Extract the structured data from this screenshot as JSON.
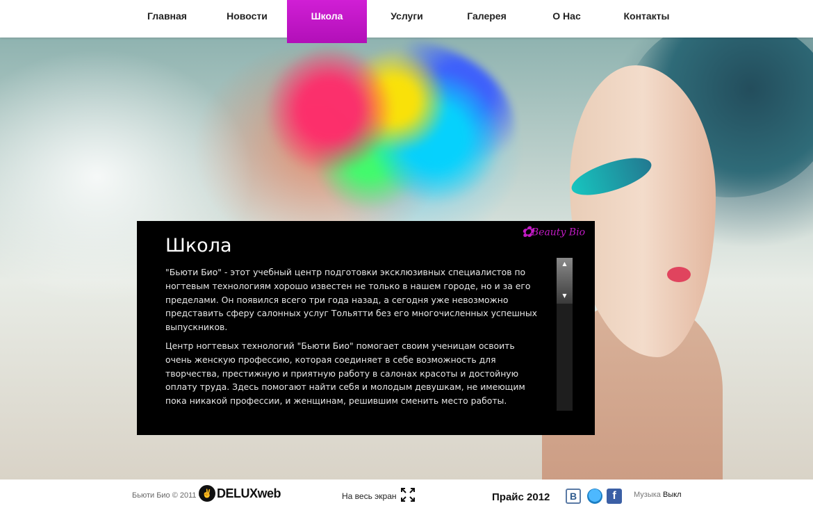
{
  "nav": {
    "items": [
      {
        "label": "Главная"
      },
      {
        "label": "Новости"
      },
      {
        "label": "Школа",
        "active": true
      },
      {
        "label": "Услуги"
      },
      {
        "label": "Галерея"
      },
      {
        "label": "О Нас"
      },
      {
        "label": "Контакты"
      }
    ],
    "active_color": "#c017c6"
  },
  "panel": {
    "title": "Школа",
    "logo_text": "Beauty Bio",
    "paragraphs": [
      "\"Бьюти Био\" - этот учебный центр подготовки эксклюзивных специалистов по ногтевым технологиям хорошо известен не только в нашем городе, но и за его пределами. Он появился всего три года назад, а сегодня уже невозможно представить сферу салонных услуг Тольятти без его многочисленных успешных выпускников.",
      "Центр ногтевых технологий \"Бьюти Био\" помогает своим ученицам освоить очень женскую профессию, которая соединяет в себе возможность для творчества, престижную и приятную работу в салонах красоты и достойную оплату труда. Здесь помогают найти себя и молодым девушкам, не имеющим пока никакой профессии, и женщинам, решившим сменить место работы."
    ]
  },
  "footer": {
    "copyright": "Бьюти Био © 2011 •",
    "partner_logo": "DELUXweb",
    "fullscreen_label": "На весь экран",
    "price_link": "Прайс 2012",
    "social_icons": [
      "vk-icon",
      "twitter-bird-icon",
      "facebook-icon"
    ],
    "music_label": "Музыка",
    "music_state": "Выкл"
  }
}
